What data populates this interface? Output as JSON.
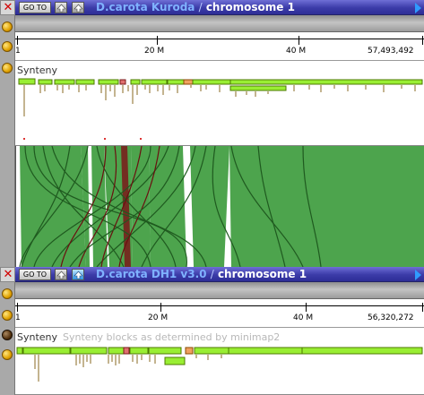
{
  "top": {
    "goto_label": "GO TO",
    "genome": "D.carota Kuroda",
    "separator": "/",
    "chromosome": "chromosome 1",
    "ruler_ticks": [
      "1",
      "20 M",
      "40 M",
      "57,493,492"
    ],
    "track_label": "Synteny",
    "track_desc": ""
  },
  "bottom": {
    "goto_label": "GO TO",
    "genome": "D.carota DH1 v3.0",
    "separator": "/",
    "chromosome": "chromosome 1",
    "ruler_ticks": [
      "1",
      "20 M",
      "40 M",
      "56,320,272"
    ],
    "track_label": "Synteny",
    "track_desc": "Synteny blocks as determined by minimap2"
  },
  "icons": {
    "close": "close-icon",
    "up": "up-arrow-icon",
    "upload": "upload-icon",
    "play": "play-arrow-icon",
    "side_buttons": "gear-icon"
  },
  "colors": {
    "titlebar": "#3b3ba8",
    "genome_text": "#7fb2ff",
    "chromosome_text": "#ffffff",
    "block_fill": "#99ee33",
    "block_border": "#4d7a00",
    "highlight_block": "#f0a060",
    "synteny_green": "#3a9a3a",
    "synteny_inverted": "#7a1a1a"
  }
}
